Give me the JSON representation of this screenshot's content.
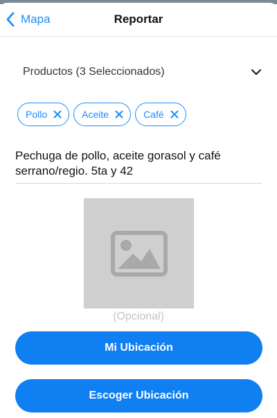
{
  "colors": {
    "accent": "#1a8cff",
    "button": "#0f7ff2",
    "placeholder": "#cfcfcf",
    "muted_text": "#c4c4c4"
  },
  "navbar": {
    "back_label": "Mapa",
    "back_icon": "chevron-left-icon",
    "title": "Reportar"
  },
  "products": {
    "label": "Productos (3 Seleccionados)",
    "icon": "chevron-down-icon",
    "chips": [
      {
        "label": "Pollo",
        "remove_icon": "close-icon"
      },
      {
        "label": "Aceite",
        "remove_icon": "close-icon"
      },
      {
        "label": "Café",
        "remove_icon": "close-icon"
      }
    ]
  },
  "description": {
    "value": "Pechuga de pollo, aceite gorasol y café serrano/regio. 5ta y 42"
  },
  "photo": {
    "icon": "image-icon",
    "caption": "(Opcional)"
  },
  "actions": {
    "my_location": "Mi Ubicación",
    "choose_location": "Escoger Ubicación"
  }
}
